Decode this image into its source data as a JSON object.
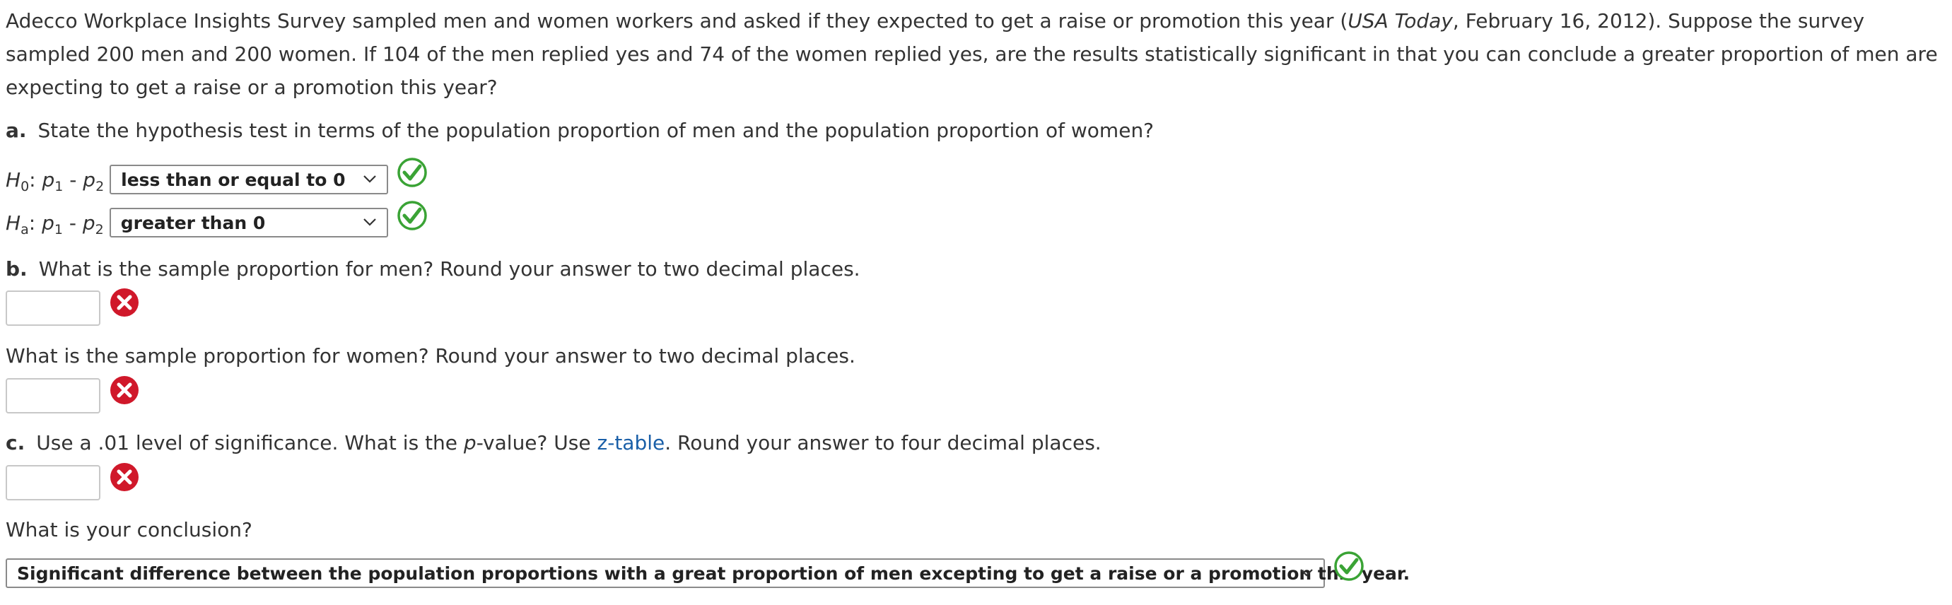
{
  "intro": {
    "text_before": "Adecco Workplace Insights Survey sampled men and women workers and asked if they expected to get a raise or promotion this year (",
    "source_italic": "USA Today",
    "text_after": ", February 16, 2012). Suppose the survey sampled 200 men and 200 women. If 104 of the men replied yes and 74 of the women replied yes, are the results statistically significant in that you can conclude a greater proportion of men are expecting to get a raise or a promotion this year?"
  },
  "part_a": {
    "letter": "a.",
    "question": "State the hypothesis test in terms of the population proportion of men and the population proportion of women?",
    "h0": {
      "label_main": "H",
      "label_sub": "0",
      "expr_p1": "p",
      "expr_p1_sub": "1",
      "expr_minus": " - ",
      "expr_p2": "p",
      "expr_p2_sub": "2",
      "selected": "less than or equal to 0",
      "status": "correct"
    },
    "ha": {
      "label_main": "H",
      "label_sub": "a",
      "expr_p1": "p",
      "expr_p1_sub": "1",
      "expr_minus": " - ",
      "expr_p2": "p",
      "expr_p2_sub": "2",
      "selected": "greater than 0",
      "status": "correct"
    }
  },
  "part_b": {
    "letter": "b.",
    "question_men": "What is the sample proportion for men? Round your answer to two decimal places.",
    "answer_men": "",
    "status_men": "incorrect",
    "question_women": "What is the sample proportion for women? Round your answer to two decimal places.",
    "answer_women": "",
    "status_women": "incorrect"
  },
  "part_c": {
    "letter": "c.",
    "q_before": "Use a .01 level of significance. What is the ",
    "q_p": "p",
    "q_mid": "-value? Use ",
    "link_text": "z-table",
    "q_after": ". Round your answer to four decimal places.",
    "answer_p": "",
    "status_p": "incorrect",
    "conclusion_question": "What is your conclusion?",
    "conclusion_selected": "Significant difference between the population proportions with a great proportion of men excepting to get a raise or a promotion this year.",
    "conclusion_status": "correct"
  },
  "colors": {
    "correct": "#3aa335",
    "incorrect": "#d0182a",
    "link": "#1a5fa8",
    "text": "#333333"
  }
}
